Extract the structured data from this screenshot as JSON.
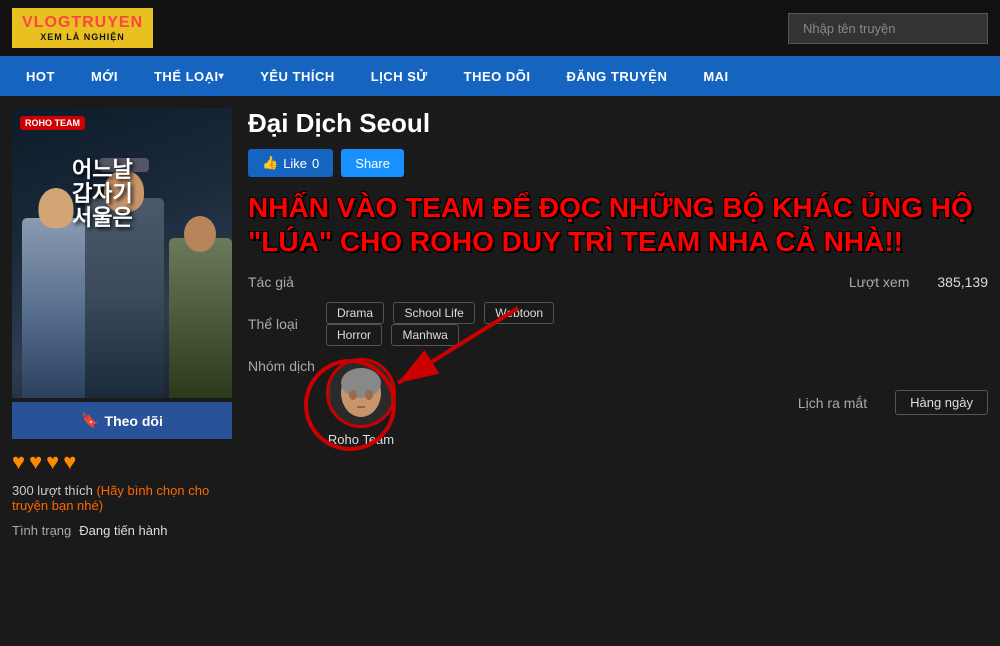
{
  "header": {
    "logo_top": "VLOGTRUYEN",
    "logo_top_highlight": "VLOG",
    "logo_bottom": "XEM LÀ NGHIỆN",
    "search_placeholder": "Nhập tên truyện"
  },
  "nav": {
    "items": [
      {
        "label": "HOT",
        "has_arrow": false
      },
      {
        "label": "MỚI",
        "has_arrow": false
      },
      {
        "label": "THỂ LOẠI",
        "has_arrow": true
      },
      {
        "label": "YÊU THÍCH",
        "has_arrow": false
      },
      {
        "label": "LỊCH SỬ",
        "has_arrow": false
      },
      {
        "label": "THEO DÕI",
        "has_arrow": false
      },
      {
        "label": "ĐĂNG TRUYỆN",
        "has_arrow": false
      },
      {
        "label": "MAI",
        "has_arrow": false
      }
    ]
  },
  "manga": {
    "title": "Đại Dịch Seoul",
    "cover_title_line1": "어느날",
    "cover_title_line2": "갑자기",
    "cover_title_line3": "서울은",
    "roho_badge": "ROHO TEAM",
    "follow_btn": "Theo dõi",
    "like_count": 0,
    "like_btn": "Like",
    "share_btn": "Share",
    "hearts": [
      "♥",
      "♥",
      "♥",
      "♥"
    ],
    "likes_count": "300 lượt thích",
    "vote_prompt": "(Hãy bình chọn cho truyện bạn nhé)",
    "status_label": "Tình trạng",
    "status_value": "Đang tiến hành",
    "promo_text": "NHẤN VÀO TEAM ĐỂ ĐỌC NHỮNG BỘ KHÁC ỦNG HỘ \"LÚA\" CHO ROHO DUY TRÌ TEAM NHA CẢ NHÀ!!",
    "tac_gia_label": "Tác giả",
    "tac_gia_value": "",
    "the_loai_label": "Thể loại",
    "tags": [
      "Drama",
      "School Life",
      "Webtoon",
      "Horror",
      "Manhwa"
    ],
    "nhom_dich_label": "Nhóm dịch",
    "group_name": "Roho Team",
    "luot_xem_label": "Lượt xem",
    "luot_xem_value": "385,139",
    "lich_ra_mat_label": "Lịch ra mắt",
    "lich_ra_mat_value": "Hàng ngày"
  }
}
